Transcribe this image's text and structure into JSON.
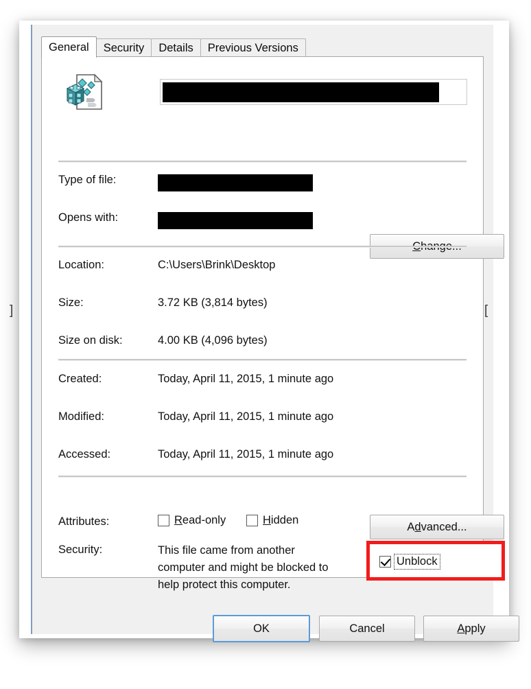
{
  "dialog": {
    "tabs": [
      {
        "label": "General",
        "active": true
      },
      {
        "label": "Security",
        "active": false
      },
      {
        "label": "Details",
        "active": false
      },
      {
        "label": "Previous Versions",
        "active": false
      }
    ],
    "file": {
      "icon": "registry-file-icon",
      "name_value": "",
      "name_redacted": true
    },
    "info_rows": [
      {
        "label": "Type of file:",
        "value": "",
        "redacted": true,
        "redaction_width": 226
      },
      {
        "label": "Opens with:",
        "value": "",
        "redacted": true,
        "redaction_width": 226
      },
      {
        "label": "Location:",
        "value": "C:\\Users\\Brink\\Desktop",
        "redacted": false
      },
      {
        "label": "Size:",
        "value": "3.72 KB (3,814 bytes)",
        "redacted": false
      },
      {
        "label": "Size on disk:",
        "value": "4.00 KB (4,096 bytes)",
        "redacted": false
      },
      {
        "label": "Created:",
        "value": "Today, April 11, 2015, 1 minute ago",
        "redacted": false
      },
      {
        "label": "Modified:",
        "value": "Today, April 11, 2015, 1 minute ago",
        "redacted": false
      },
      {
        "label": "Accessed:",
        "value": "Today, April 11, 2015, 1 minute ago",
        "redacted": false
      }
    ],
    "change_button": "Change...",
    "attributes": {
      "label": "Attributes:",
      "read_only": {
        "label_pre": "",
        "accel": "R",
        "label_post": "ead-only",
        "checked": false
      },
      "hidden": {
        "label_pre": "",
        "accel": "H",
        "label_post": "idden",
        "checked": false
      },
      "advanced_button": {
        "pre": "A",
        "accel": "d",
        "post": "vanced..."
      }
    },
    "security": {
      "label": "Security:",
      "description": "This file came from another computer and might be blocked to help protect this computer.",
      "unblock": {
        "label": "Unblock",
        "checked": true,
        "highlight_color": "#f11d1d"
      }
    },
    "buttons": {
      "ok": "OK",
      "cancel": "Cancel",
      "apply": {
        "accel": "A",
        "rest": "pply"
      }
    },
    "edge_marks": {
      "left": "]",
      "right": "["
    }
  }
}
